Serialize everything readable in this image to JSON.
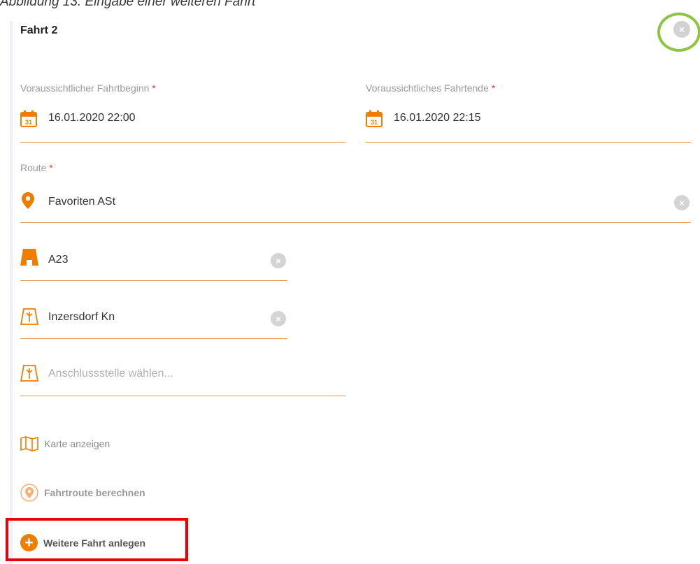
{
  "caption": "Abbildung 13: Eingabe einer weiteren Fahrt",
  "title": "Fahrt 2",
  "close_glyph": "×",
  "start": {
    "label": "Voraussichtlicher Fahrtbeginn",
    "required": "*",
    "value": "16.01.2020 22:00",
    "icon_day": "31"
  },
  "end": {
    "label": "Voraussichtliches Fahrtende",
    "required": "*",
    "value": "16.01.2020 22:15",
    "icon_day": "31"
  },
  "route": {
    "label": "Route",
    "required": "*",
    "value": "Favoriten ASt"
  },
  "road": {
    "value": "A23"
  },
  "junction": {
    "value": "Inzersdorf Kn"
  },
  "junction_new": {
    "placeholder": "Anschlussstelle wählen..."
  },
  "actions": {
    "show_map": "Karte anzeigen",
    "calc_route": "Fahrtroute berechnen",
    "add_trip": "Weitere Fahrt anlegen",
    "add_glyph": "+"
  },
  "colors": {
    "accent": "#ef7d00",
    "underline": "#e89a4a",
    "highlight_green": "#8cc63f",
    "highlight_red": "#e8000b"
  },
  "icons": [
    "calendar-icon",
    "location-pin-icon",
    "highway-icon",
    "exit-sign-icon",
    "map-icon",
    "route-pin-icon",
    "plus-icon",
    "close-icon"
  ]
}
